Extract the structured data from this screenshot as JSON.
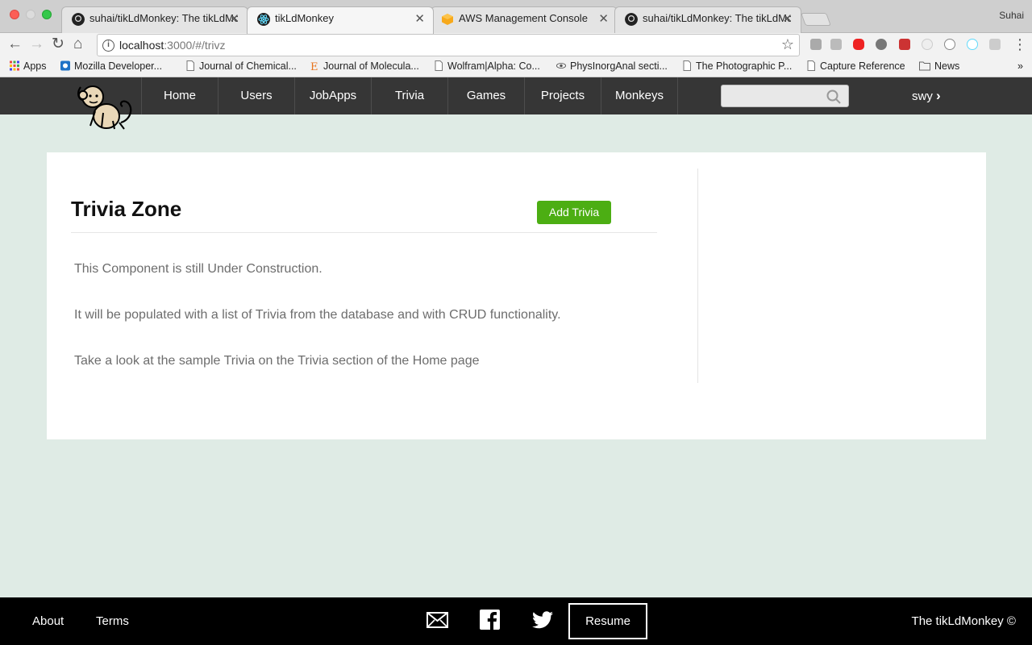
{
  "browser": {
    "profile_name": "Suhai",
    "tabs": [
      {
        "title": "suhai/tikLdMonkey: The tikLdMonkey",
        "icon": "github-icon"
      },
      {
        "title": "tikLdMonkey",
        "icon": "react-icon"
      },
      {
        "title": "AWS Management Console",
        "icon": "aws-box-icon"
      },
      {
        "title": "suhai/tikLdMonkey: The tikLdMonkey",
        "icon": "github-icon"
      }
    ],
    "url_host": "localhost",
    "url_path": ":3000/#/trivz",
    "bookmarks": [
      {
        "label": "Apps",
        "icon": "apps-grid-icon"
      },
      {
        "label": "Mozilla Developer...",
        "icon": "mdn-icon"
      },
      {
        "label": "Journal of Chemical...",
        "icon": "page-icon"
      },
      {
        "label": "Journal of Molecula...",
        "icon": "elsevier-icon"
      },
      {
        "label": "Wolfram|Alpha: Co...",
        "icon": "page-icon"
      },
      {
        "label": "PhysInorgAnal secti...",
        "icon": "eye-icon"
      },
      {
        "label": "The Photographic P...",
        "icon": "page-icon"
      },
      {
        "label": "Capture Reference",
        "icon": "page-icon"
      },
      {
        "label": "News",
        "icon": "folder-icon"
      }
    ]
  },
  "nav": {
    "items": [
      "Home",
      "Users",
      "JobApps",
      "Trivia",
      "Games",
      "Projects",
      "Monkeys"
    ],
    "user_label": "swy",
    "user_chevron": "›"
  },
  "main": {
    "title": "Trivia Zone",
    "add_button": "Add Trivia",
    "paragraphs": [
      "This Component is still Under Construction.",
      "It will be populated with a list of Trivia from the database and with CRUD functionality.",
      "Take a look at the sample Trivia on the Trivia section of the Home page"
    ]
  },
  "footer": {
    "about": "About",
    "terms": "Terms",
    "resume": "Resume",
    "copyright": "The tikLdMonkey ©",
    "icons": [
      "mail-icon",
      "facebook-icon",
      "twitter-icon"
    ]
  },
  "colors": {
    "accent_green": "#4cae13",
    "navbar": "#363636",
    "page_bg": "#dfebe5",
    "footer_bg": "#000000"
  }
}
